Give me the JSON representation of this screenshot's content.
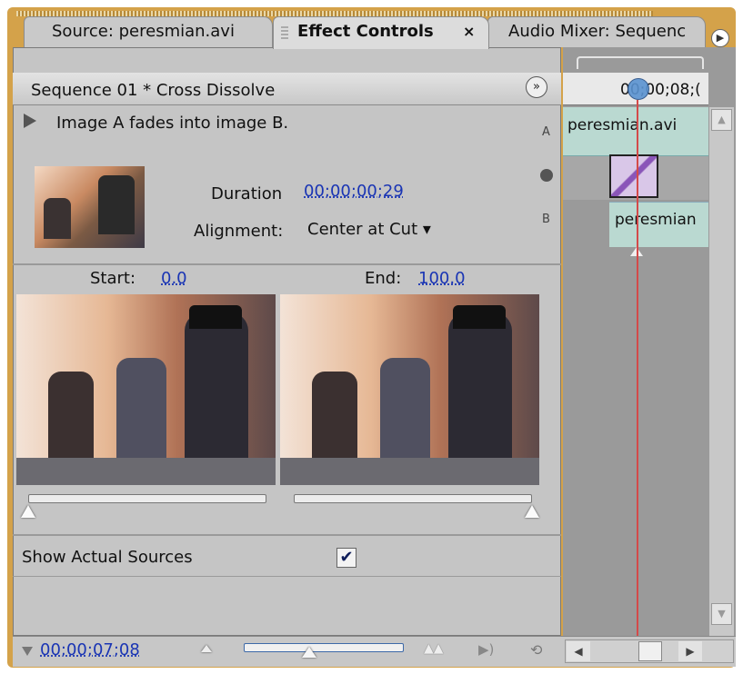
{
  "tabs": {
    "source": "Source: peresmian.avi",
    "effect_controls": "Effect Controls",
    "effect_controls_close": "×",
    "audio_mixer": "Audio Mixer: Sequenc"
  },
  "sequence": {
    "title": "Sequence 01 * Cross Dissolve",
    "expand_symbol": "»"
  },
  "transition": {
    "description": "Image A fades into image B.",
    "label_a": "A",
    "label_b": "B",
    "duration_label": "Duration",
    "duration_value": "00;00;00;29",
    "alignment_label": "Alignment:",
    "alignment_value": "Center at Cut ▾",
    "start_label": "Start:",
    "start_value": "0.0",
    "end_label": "End:",
    "end_value": "100.0",
    "start_percent": 0.0,
    "end_percent": 100.0,
    "show_sources_label": "Show Actual Sources",
    "show_sources_checked": true,
    "check_glyph": "✔"
  },
  "timeline": {
    "ruler_timecode": "00;00;08;(",
    "clip_a": "peresmian.avi",
    "clip_b": "peresmian"
  },
  "bottom": {
    "timecode": "00;00;07;08",
    "zoom_in_glyph": "▲▲",
    "play_audio_glyph": "▶)",
    "loop_glyph": "⟲"
  },
  "icons": {
    "panel_menu": "panel-menu-icon",
    "scroll_up": "▲",
    "scroll_down": "▼",
    "scroll_left": "◀",
    "scroll_right": "▶"
  },
  "colors": {
    "panel_frame": "#d4a24a",
    "link_value": "#1a35b4",
    "clip": "#bad9d1",
    "transition": "#8a55b8",
    "playhead": "#d44a4a"
  }
}
